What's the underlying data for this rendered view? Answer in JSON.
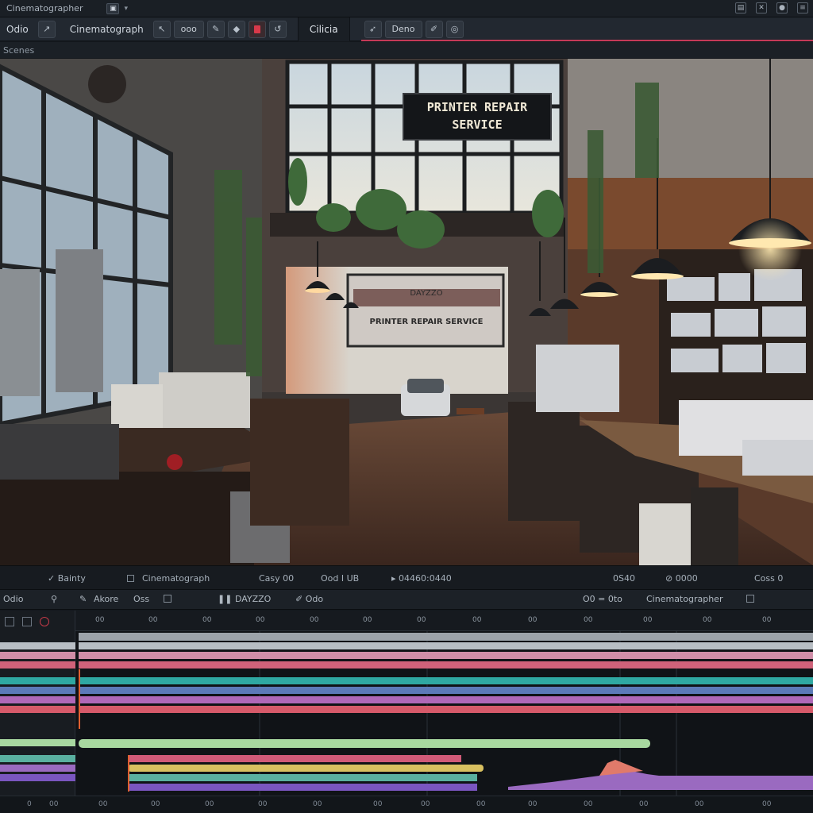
{
  "titlebar": {
    "title": "Cinematographer",
    "icon": "window-icon"
  },
  "toolbar": {
    "items": [
      "Odio",
      "Cinematograph"
    ],
    "pill1": "ooo",
    "tab_active": "Cilicia",
    "pill2": "Deno",
    "colors": {
      "accent": "#c43a58",
      "record": "#d8394a"
    }
  },
  "subbar": {
    "label": "Scenes"
  },
  "viewer": {
    "sign_line1": "PRINTER REPAIR",
    "sign_line2": "SERVICE",
    "storefront_line1": "DAYZZO",
    "storefront_line2": "PRINTER REPAIR SERVICE"
  },
  "infobar": {
    "items": [
      "Bainty",
      "Cinematograph",
      "Casy 00",
      "Ood I UB",
      "04460:0440",
      "0S40",
      "0000",
      "Coss 0"
    ]
  },
  "tlheader": {
    "left": "Odio",
    "mid1": "Akore",
    "mid2": "Oss",
    "mid3": "DAYZZO",
    "mid4": "Odo",
    "right1": "O0 = 0to",
    "right2": "Cinematographer"
  },
  "ruler": {
    "ticks": [
      "00",
      "00",
      "00",
      "00",
      "00",
      "00",
      "00",
      "00",
      "00",
      "00",
      "00",
      "00",
      "00"
    ]
  },
  "footer": {
    "ticks": [
      "0",
      "00",
      "00",
      "00",
      "00",
      "00",
      "00",
      "00",
      "00",
      "00",
      "00",
      "00",
      "00",
      "00",
      "00"
    ]
  }
}
